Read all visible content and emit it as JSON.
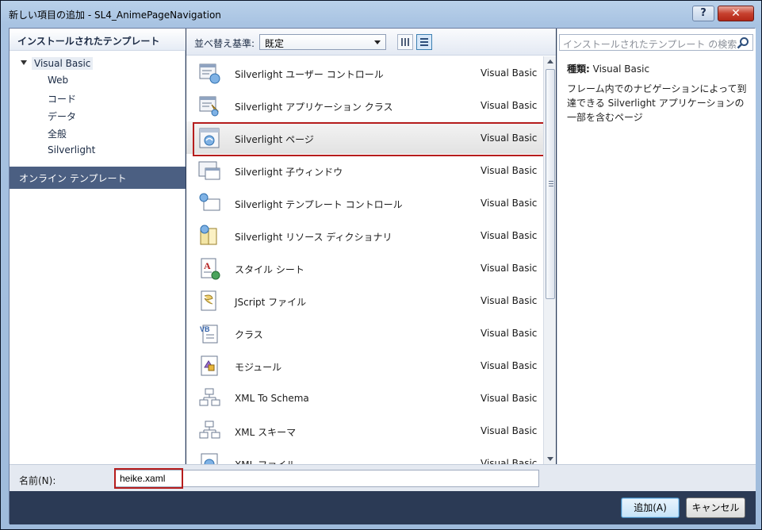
{
  "window": {
    "title": "新しい項目の追加 - SL4_AnimePageNavigation",
    "help_label": "?",
    "close_label": "✕"
  },
  "left": {
    "header": "インストールされたテンプレート",
    "tree_root": "Visual Basic",
    "tree_children": [
      "Web",
      "コード",
      "データ",
      "全般",
      "Silverlight"
    ],
    "online": "オンライン テンプレート"
  },
  "toolbar": {
    "sort_label": "並べ替え基準:",
    "sort_value": "既定"
  },
  "search": {
    "placeholder": "インストールされたテンプレート の検索"
  },
  "templates": [
    {
      "name": "Silverlight ユーザー コントロール",
      "lang": "Visual Basic",
      "icon": "user-control-icon"
    },
    {
      "name": "Silverlight アプリケーション クラス",
      "lang": "Visual Basic",
      "icon": "application-class-icon"
    },
    {
      "name": "Silverlight ページ",
      "lang": "Visual Basic",
      "icon": "silverlight-page-icon"
    },
    {
      "name": "Silverlight 子ウィンドウ",
      "lang": "Visual Basic",
      "icon": "child-window-icon"
    },
    {
      "name": "Silverlight テンプレート コントロール",
      "lang": "Visual Basic",
      "icon": "templated-control-icon"
    },
    {
      "name": "Silverlight リソース ディクショナリ",
      "lang": "Visual Basic",
      "icon": "resource-dictionary-icon"
    },
    {
      "name": "スタイル シート",
      "lang": "Visual Basic",
      "icon": "style-sheet-icon"
    },
    {
      "name": "JScript ファイル",
      "lang": "Visual Basic",
      "icon": "jscript-file-icon"
    },
    {
      "name": "クラス",
      "lang": "Visual Basic",
      "icon": "vb-class-icon"
    },
    {
      "name": "モジュール",
      "lang": "Visual Basic",
      "icon": "module-icon"
    },
    {
      "name": "XML To Schema",
      "lang": "Visual Basic",
      "icon": "xml-schema-icon"
    },
    {
      "name": "XML スキーマ",
      "lang": "Visual Basic",
      "icon": "xml-schema-icon"
    },
    {
      "name": "XML ファイル",
      "lang": "Visual Basic",
      "icon": "xml-file-icon"
    }
  ],
  "selected_index": 2,
  "details": {
    "type_key": "種類:",
    "type_value": "Visual Basic",
    "description": "フレーム内でのナビゲーションによって到達できる Silverlight アプリケーションの一部を含むページ"
  },
  "name_field": {
    "label": "名前(N):",
    "value": "heike.xaml"
  },
  "buttons": {
    "add": "追加(A)",
    "cancel": "キャンセル"
  },
  "colors": {
    "highlight_red": "#b61d1d",
    "online_band": "#4b5f82",
    "frame": "#2b3a55"
  }
}
